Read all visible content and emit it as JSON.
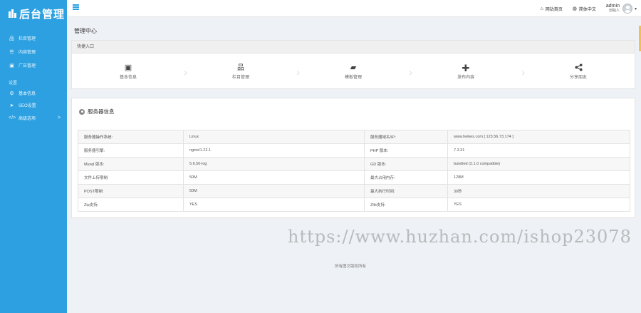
{
  "sidebar": {
    "logo_text": "后台管理",
    "items": [
      {
        "label": "栏目管理",
        "icon": "sitemap-icon"
      },
      {
        "label": "内容管理",
        "icon": "list-icon"
      },
      {
        "label": "广告管理",
        "icon": "image-icon"
      }
    ],
    "section_label": "设置",
    "settings_items": [
      {
        "label": "基本信息",
        "icon": "gear-icon"
      },
      {
        "label": "SEO设置",
        "icon": "send-icon"
      },
      {
        "label": "高级选项",
        "icon": "code-icon"
      }
    ]
  },
  "topbar": {
    "site_home": "网站首页",
    "language": "简体中文",
    "user_name": "admin",
    "user_role": "创始人"
  },
  "main": {
    "page_title": "管理中心",
    "quick": {
      "header": "快捷入口",
      "items": [
        {
          "label": "基本信息",
          "icon": "id-card-icon",
          "glyph": "▣"
        },
        {
          "label": "栏目管理",
          "icon": "sitemap-icon",
          "glyph": "品"
        },
        {
          "label": "模板管理",
          "icon": "folder-open-icon",
          "glyph": "▰"
        },
        {
          "label": "发布内容",
          "icon": "plus-icon",
          "glyph": "✚"
        },
        {
          "label": "分享朋友",
          "icon": "share-icon",
          "glyph": "<"
        }
      ]
    },
    "server": {
      "title": "服务器信息",
      "rows": [
        [
          "服务器操作系统:",
          "Linux",
          "服务器域名/IP:",
          "www.heikes.com [ 123.56.73.174 ]"
        ],
        [
          "服务器引擎:",
          "nginx/1.22.1",
          "PHP 版本:",
          "7.3.31"
        ],
        [
          "Mysql 版本:",
          "5.6.50-log",
          "GD 版本:",
          "bundled (2.1.0 compatible)"
        ],
        [
          "文件上传限制:",
          "50M",
          "最大占用内存:",
          "128M"
        ],
        [
          "POST限制:",
          "50M",
          "最大执行时间:",
          "30秒"
        ],
        [
          "Zip支持:",
          "YES",
          "Zlib支持:",
          "YES"
        ]
      ]
    }
  },
  "footer": "所有图文版权所有",
  "watermark": "https://www.huzhan.com/ishop23078",
  "colors": {
    "sidebar": "#2ca0e0",
    "accent_edge": "#f5c04a"
  }
}
